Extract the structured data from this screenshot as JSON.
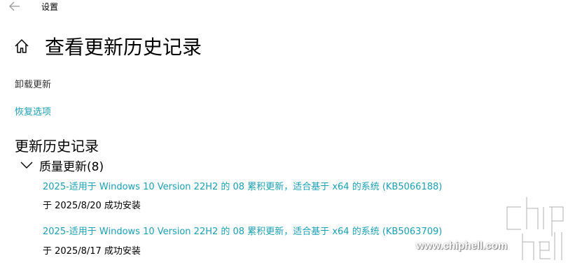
{
  "window": {
    "title": "设置",
    "back_icon": "arrow-left-icon"
  },
  "header": {
    "home_icon": "home-icon",
    "title": "查看更新历史记录"
  },
  "links": {
    "uninstall": "卸载更新",
    "recovery": "恢复选项"
  },
  "history": {
    "section_title": "更新历史记录",
    "groups": [
      {
        "title": "质量更新(8)",
        "expanded": true,
        "items": [
          {
            "name": "2025-适用于 Windows 10 Version 22H2 的 08 累积更新，适合基于 x64 的系统 (KB5066188)",
            "status": "于 2025/8/20 成功安装"
          },
          {
            "name": "2025-适用于 Windows 10 Version 22H2 的 08 累积更新，适合基于 x64 的系统 (KB5063709)",
            "status": "于 2025/8/17 成功安装"
          }
        ]
      }
    ]
  },
  "watermark": {
    "text": "www.chiphell.com",
    "logo_text": "chip hell"
  },
  "colors": {
    "link": "#1a9fb5",
    "text": "#000000",
    "muted": "#333333",
    "background": "#ffffff"
  }
}
